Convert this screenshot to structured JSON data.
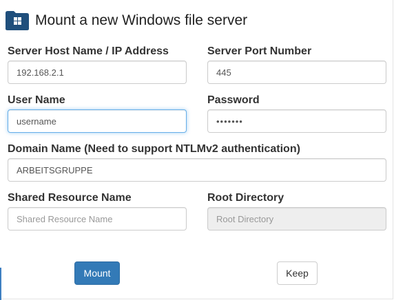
{
  "dialog": {
    "title": "Mount a new Windows file server",
    "icon": "folder-windows-icon",
    "accent_color": "#1f4f7c"
  },
  "form": {
    "host": {
      "label": "Server Host Name / IP Address",
      "value": "192.168.2.1",
      "placeholder": ""
    },
    "port": {
      "label": "Server Port Number",
      "value": "445",
      "placeholder": ""
    },
    "user": {
      "label": "User Name",
      "value": "username",
      "placeholder": ""
    },
    "password": {
      "label": "Password",
      "value": "1234567",
      "placeholder": ""
    },
    "domain": {
      "label": "Domain Name (Need to support NTLMv2 authentication)",
      "value": "ARBEITSGRUPPE",
      "placeholder": ""
    },
    "share": {
      "label": "Shared Resource Name",
      "value": "",
      "placeholder": "Shared Resource Name"
    },
    "root": {
      "label": "Root Directory",
      "value": "",
      "placeholder": "Root Directory"
    }
  },
  "buttons": {
    "mount": "Mount",
    "keep": "Keep"
  },
  "colors": {
    "primary": "#337ab7",
    "focus": "#66afe9"
  }
}
